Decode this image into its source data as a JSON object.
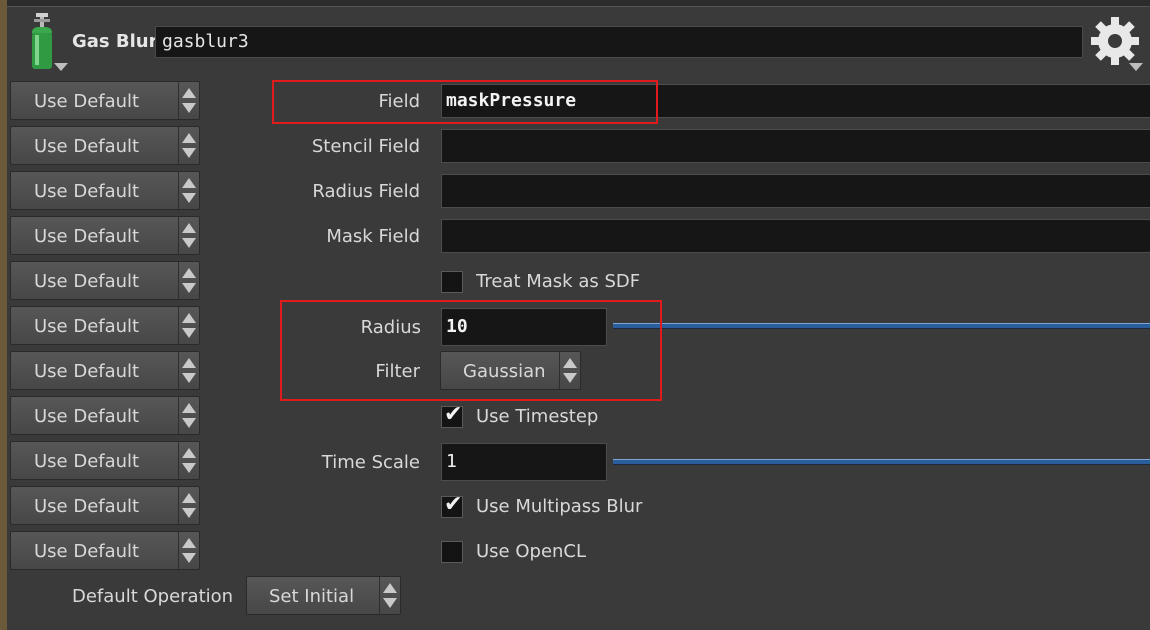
{
  "node": {
    "type_label": "Gas Blur",
    "name": "gasblur3",
    "icon": "gas-cylinder-icon",
    "gear_icon": "gear-icon"
  },
  "use_default_label": "Use Default",
  "params": {
    "field": {
      "label": "Field",
      "value": "maskPressure"
    },
    "stencil_field": {
      "label": "Stencil Field",
      "value": ""
    },
    "radius_field": {
      "label": "Radius Field",
      "value": ""
    },
    "mask_field": {
      "label": "Mask Field",
      "value": ""
    },
    "treat_mask_sdf": {
      "label": "Treat Mask as SDF",
      "checked": false
    },
    "radius": {
      "label": "Radius",
      "value": "10"
    },
    "filter": {
      "label": "Filter",
      "value": "Gaussian"
    },
    "use_timestep": {
      "label": "Use Timestep",
      "checked": true
    },
    "time_scale": {
      "label": "Time Scale",
      "value": "1"
    },
    "use_multipass_blur": {
      "label": "Use Multipass Blur",
      "checked": true
    },
    "use_opencl": {
      "label": "Use OpenCL",
      "checked": false
    },
    "default_operation": {
      "label": "Default Operation",
      "value": "Set Initial"
    }
  },
  "colors": {
    "highlight": "#e01b1b",
    "slider": "#2a5d9c",
    "background": "#3a3a3a"
  }
}
